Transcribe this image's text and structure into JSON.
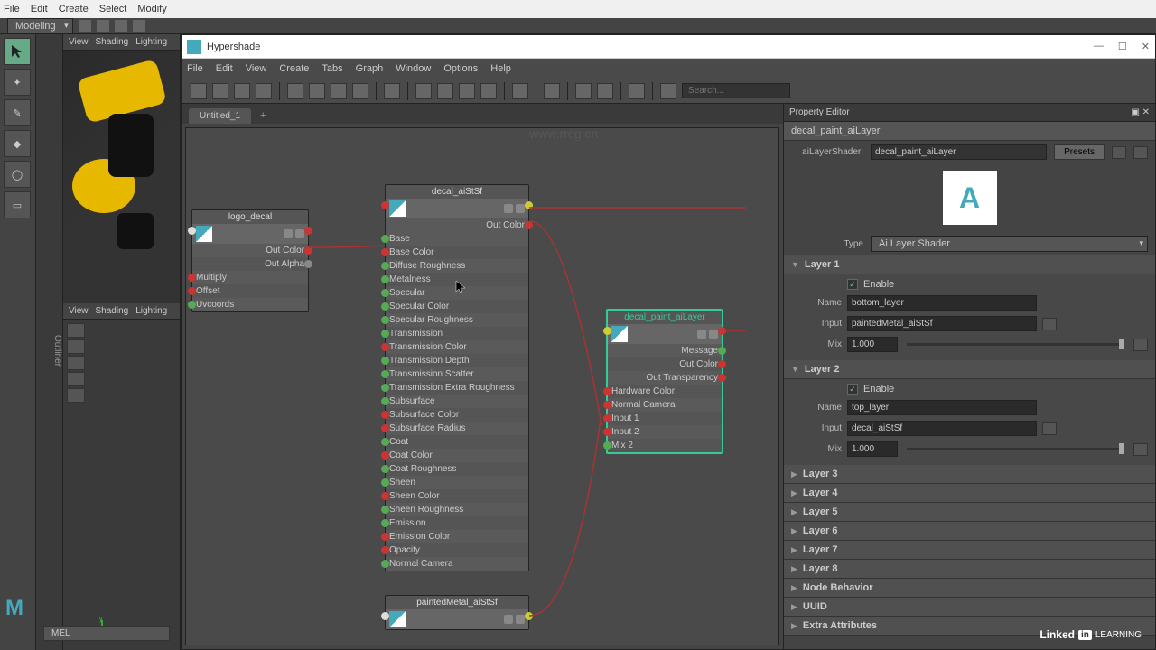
{
  "mainMenu": [
    "File",
    "Edit",
    "Create",
    "Select",
    "Modify"
  ],
  "workspace": "Modeling",
  "viewportTabs": [
    "View",
    "Shading",
    "Lighting"
  ],
  "melLabel": "MEL",
  "outlinerLabel": "Outliner",
  "hypershade": {
    "title": "Hypershade",
    "menu": [
      "File",
      "Edit",
      "View",
      "Create",
      "Tabs",
      "Graph",
      "Window",
      "Options",
      "Help"
    ],
    "searchPlaceholder": "Search...",
    "tabName": "Untitled_1",
    "url_watermark": "www.rrcg.cn"
  },
  "nodes": {
    "logo_decal": {
      "title": "logo_decal",
      "outputs": [
        "Out Color",
        "Out Alpha"
      ],
      "inputs": [
        "Multiply",
        "Offset",
        "Uvcoords"
      ]
    },
    "decal_aiStSf": {
      "title": "decal_aiStSf",
      "outColor": "Out Color",
      "attrs": [
        "Base",
        "Base Color",
        "Diffuse Roughness",
        "Metalness",
        "Specular",
        "Specular Color",
        "Specular Roughness",
        "Transmission",
        "Transmission Color",
        "Transmission Depth",
        "Transmission Scatter",
        "Transmission Extra Roughness",
        "Subsurface",
        "Subsurface Color",
        "Subsurface Radius",
        "Coat",
        "Coat Color",
        "Coat Roughness",
        "Sheen",
        "Sheen Color",
        "Sheen Roughness",
        "Emission",
        "Emission Color",
        "Opacity",
        "Normal Camera"
      ]
    },
    "decal_paint_aiLayer": {
      "title": "decal_paint_aiLayer",
      "outputs": [
        "Message",
        "Out Color",
        "Out Transparency"
      ],
      "inputs": [
        "Hardware Color",
        "Normal Camera",
        "Input 1",
        "Input 2",
        "Mix 2"
      ]
    },
    "paintedMetal_aiStSf": {
      "title": "paintedMetal_aiStSf"
    }
  },
  "portColors": {
    "Base": "green",
    "Base Color": "red",
    "Diffuse Roughness": "green",
    "Metalness": "green",
    "Specular": "green",
    "Specular Color": "green",
    "Specular Roughness": "green",
    "Transmission": "green",
    "Transmission Color": "red",
    "Transmission Depth": "green",
    "Transmission Scatter": "green",
    "Transmission Extra Roughness": "green",
    "Subsurface": "green",
    "Subsurface Color": "red",
    "Subsurface Radius": "red",
    "Coat": "green",
    "Coat Color": "red",
    "Coat Roughness": "green",
    "Sheen": "green",
    "Sheen Color": "red",
    "Sheen Roughness": "green",
    "Emission": "green",
    "Emission Color": "red",
    "Opacity": "red",
    "Normal Camera": "green"
  },
  "propertyEditor": {
    "header": "Property Editor",
    "nodeName": "decal_paint_aiLayer",
    "typeLabel": "aiLayerShader:",
    "typeValue": "decal_paint_aiLayer",
    "presets": "Presets",
    "typeField": "Type",
    "typeFieldValue": "Ai Layer Shader",
    "layers": {
      "1": {
        "title": "Layer 1",
        "enable": "Enable",
        "name": "bottom_layer",
        "input": "paintedMetal_aiStSf",
        "mix": "1.000"
      },
      "2": {
        "title": "Layer 2",
        "enable": "Enable",
        "name": "top_layer",
        "input": "decal_aiStSf",
        "mix": "1.000"
      }
    },
    "collapsedLayers": [
      "Layer 3",
      "Layer 4",
      "Layer 5",
      "Layer 6",
      "Layer 7",
      "Layer 8"
    ],
    "extraSections": [
      "Node Behavior",
      "UUID",
      "Extra Attributes"
    ],
    "labels": {
      "name": "Name",
      "input": "Input",
      "mix": "Mix"
    }
  },
  "linkedin": {
    "brand": "Linked",
    "in": "in",
    "learning": "LEARNING"
  }
}
